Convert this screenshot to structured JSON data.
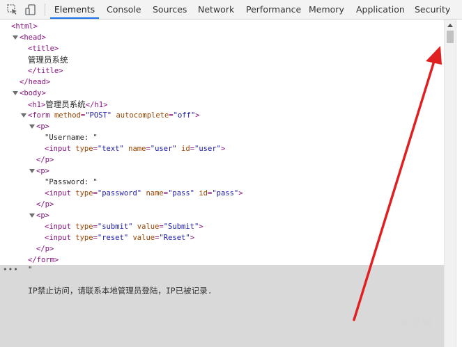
{
  "toolbar": {
    "tabs": [
      {
        "label": "Elements",
        "active": true
      },
      {
        "label": "Console"
      },
      {
        "label": "Sources"
      },
      {
        "label": "Network"
      },
      {
        "label": "Performance"
      },
      {
        "label": "Memory"
      },
      {
        "label": "Application"
      },
      {
        "label": "Security"
      }
    ],
    "icons": [
      "inspect-element-icon",
      "device-toolbar-icon"
    ]
  },
  "dom": {
    "l1": "<html>",
    "l2": "<head>",
    "l3": "<title>",
    "l4": "管理员系统",
    "l5": "</title>",
    "l6": "</head>",
    "l7": "<body>",
    "h1_open": "<h1>",
    "h1_text": "管理员系统",
    "h1_close": "</h1>",
    "form_open": "<form",
    "form_attr1": "method",
    "form_val1": "\"POST\"",
    "form_attr2": "autocomplete",
    "form_val2": "\"off\"",
    "p_open": "<p>",
    "p_close": "</p>",
    "username_text": "\"Username: \"",
    "password_text": "\"Password: \"",
    "input_open": "<input",
    "type_attr": "type",
    "name_attr": "name",
    "id_attr": "id",
    "value_attr": "value",
    "text_val": "\"text\"",
    "user_val": "\"user\"",
    "password_val": "\"password\"",
    "pass_val": "\"pass\"",
    "submit_val": "\"submit\"",
    "Submit_val": "\"Submit\"",
    "reset_val": "\"reset\"",
    "Reset_val": "\"Reset\"",
    "gt": ">",
    "form_close": "</form>",
    "quote": "\"",
    "ban_text": "IP禁止访问，请联系本地管理员登陆，IP已被记录."
  },
  "colors": {
    "tag": "#881280",
    "attr": "#994500",
    "value": "#1a1aa6",
    "arrow": "#e02020",
    "active_tab": "#1a73e8",
    "selection": "#d9d9d9"
  },
  "watermark": "亿速"
}
